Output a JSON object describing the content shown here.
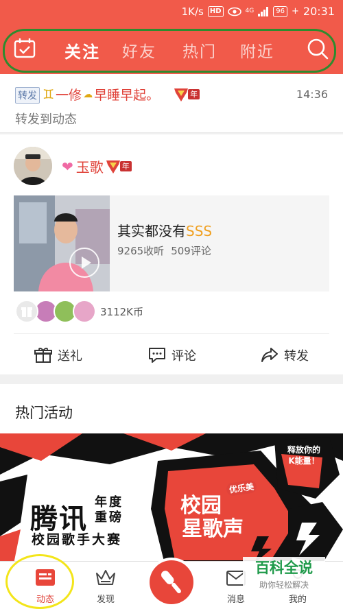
{
  "status_bar": {
    "speed": "1K/s",
    "hd": "HD",
    "network": "4G",
    "battery": "96",
    "time": "20:31"
  },
  "header": {
    "tabs": [
      "关注",
      "好友",
      "热门",
      "附近"
    ],
    "active_tab": 0,
    "left_icon": "calendar-icon",
    "right_icon": "search-icon",
    "color": "#f15a4a"
  },
  "repost": {
    "tag": "转发",
    "user": "一修",
    "user_suffix": "早睡早起。",
    "level_badge": "年",
    "time": "14:36",
    "subtitle": "转发到动态"
  },
  "post": {
    "user": "玉歌",
    "level_badge": "年",
    "song_title": "其实都没有",
    "song_title_tag": "SSS",
    "listens": "9265收听",
    "comments": "509评论",
    "coins": "3112K币",
    "actions": {
      "gift": "送礼",
      "comment": "评论",
      "share": "转发"
    }
  },
  "hot_section": {
    "title": "热门活动",
    "banner": {
      "brand": "腾讯",
      "line1": "年度",
      "line2": "重磅",
      "subtitle": "校园歌手大赛",
      "event_line1": "校园",
      "event_line2": "星歌声",
      "sponsor": "优乐美",
      "callout": "释放你的K能量！"
    }
  },
  "bottom_nav": {
    "items": [
      "动态",
      "发现",
      "消息",
      "我的"
    ],
    "active": 0
  },
  "watermark": {
    "title": "百科全说",
    "subtitle": "助你轻松解决"
  }
}
